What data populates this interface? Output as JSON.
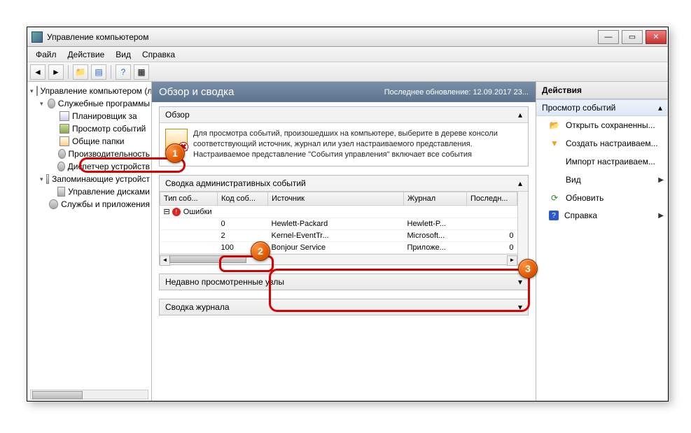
{
  "window": {
    "title": "Управление компьютером"
  },
  "menubar": [
    "Файл",
    "Действие",
    "Вид",
    "Справка"
  ],
  "toolbar_icons": [
    "back-icon",
    "forward-icon",
    "up-icon",
    "show-hide-tree-icon",
    "help-icon",
    "properties-icon"
  ],
  "tree": {
    "root": "Управление компьютером (л",
    "groups": [
      {
        "label": "Служебные программы",
        "children": [
          {
            "label": "Планировщик за",
            "icon": "clock"
          },
          {
            "label": "Просмотр событий",
            "icon": "book",
            "hl": true
          },
          {
            "label": "Общие папки",
            "icon": "fold"
          },
          {
            "label": "Производительность",
            "icon": "gear"
          },
          {
            "label": "Диспетчер устройств",
            "icon": "gear"
          }
        ]
      },
      {
        "label": "Запоминающие устройст",
        "children": [
          {
            "label": "Управление дисками",
            "icon": "disk"
          }
        ]
      },
      {
        "label": "Службы и приложения",
        "children": []
      }
    ]
  },
  "center": {
    "title": "Обзор и сводка",
    "updated": "Последнее обновление: 12.09.2017 23...",
    "overview_header": "Обзор",
    "overview_text": "Для просмотра событий, произошедших на компьютере, выберите в дереве консоли соответствующий источник, журнал или узел настраиваемого представления. Настраиваемое представление \"События управления\" включает все события",
    "admin_summary_header": "Сводка административных событий",
    "columns": [
      "Тип соб...",
      "Код соб...",
      "Источник",
      "Журнал",
      "Последн..."
    ],
    "error_row_label": "Ошибки",
    "rows": [
      {
        "code": "0",
        "source": "Hewlett-Packard",
        "log": "Hewlett-P...",
        "last": ""
      },
      {
        "code": "2",
        "source": "Kernel-EventTr...",
        "log": "Microsoft...",
        "last": "0"
      },
      {
        "code": "100",
        "source": "Bonjour Service",
        "log": "Приложе...",
        "last": "0"
      }
    ],
    "recent_header": "Недавно просмотренные узлы",
    "logsum_header": "Сводка журнала"
  },
  "actions": {
    "header": "Действия",
    "subheader": "Просмотр событий",
    "items": [
      {
        "icon": "📂",
        "label": "Открыть сохраненны...",
        "name": "open-saved"
      },
      {
        "icon": "▼",
        "color": "#e6a817",
        "label": "Создать настраиваем...",
        "name": "create-custom"
      },
      {
        "icon": "",
        "label": "Импорт настраиваем...",
        "name": "import-custom"
      },
      {
        "icon": "",
        "label": "Вид",
        "name": "view",
        "arrow": true
      },
      {
        "icon": "⟳",
        "color": "#2a8a2a",
        "label": "Обновить",
        "name": "refresh"
      },
      {
        "icon": "?",
        "color": "#2a5aca",
        "label": "Справка",
        "name": "help",
        "arrow": true
      }
    ]
  },
  "markers": {
    "1": "1",
    "2": "2",
    "3": "3"
  }
}
